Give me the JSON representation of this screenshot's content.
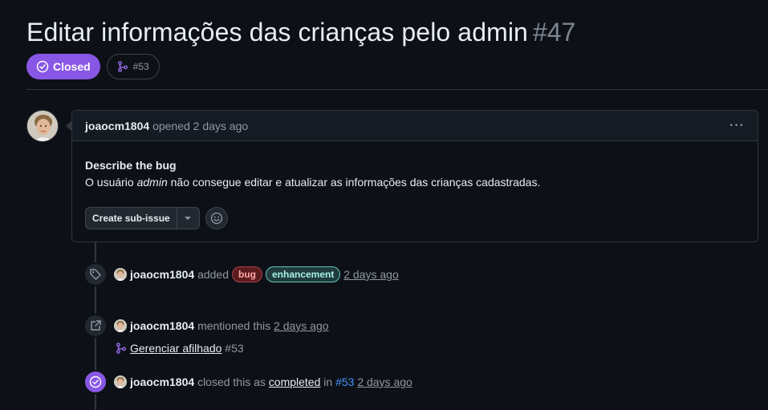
{
  "issue": {
    "title": "Editar informações das crianças pelo admin",
    "number": "#47",
    "state": "Closed",
    "linked_pr": "#53"
  },
  "comment": {
    "author": "joaocm1804",
    "opened_text": "opened",
    "time": "2 days ago",
    "heading": "Describe the bug",
    "body_before": "O usuário ",
    "body_em": "admin",
    "body_after": " não consegue editar e atualizar as informações das crianças cadastradas.",
    "create_sub_issue": "Create sub-issue"
  },
  "events": [
    {
      "user": "joaocm1804",
      "action": "added",
      "labels": [
        "bug",
        "enhancement"
      ],
      "time": "2 days ago"
    },
    {
      "user": "joaocm1804",
      "action": "mentioned this",
      "time": "2 days ago",
      "ref_title": "Gerenciar afilhado",
      "ref_num": "#53"
    },
    {
      "user": "joaocm1804",
      "action": "closed this as",
      "completed": "completed",
      "in": "in",
      "ref": "#53",
      "time": "2 days ago"
    }
  ],
  "colors": {
    "closed": "#8957e5",
    "bug": "#a8404a",
    "enhancement": "#67c3bc"
  }
}
